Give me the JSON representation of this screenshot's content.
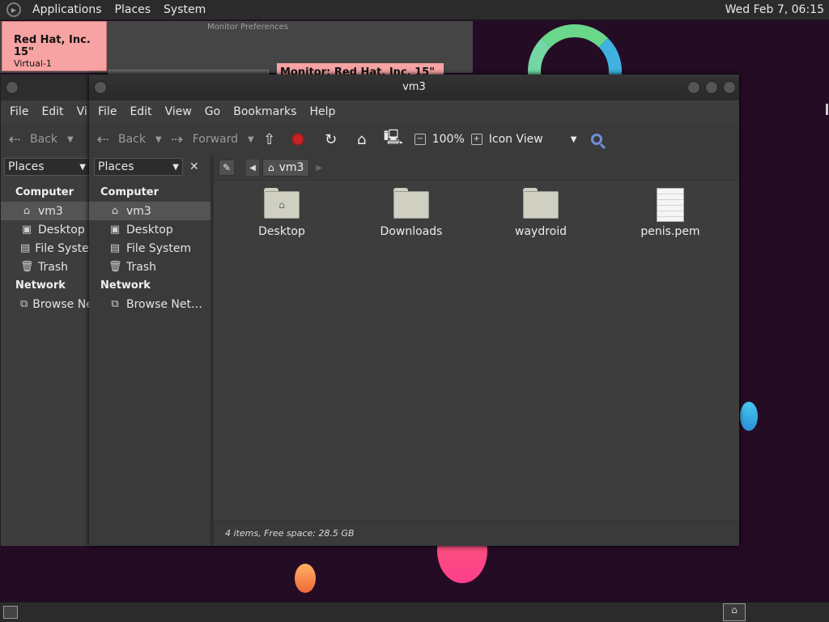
{
  "top_panel": {
    "menus": [
      "Applications",
      "Places",
      "System"
    ],
    "clock": "Wed Feb  7, 06:15"
  },
  "monitor_prefs": {
    "title": "Monitor Preferences",
    "card_title": "Red Hat, Inc. 15\"",
    "card_sub": "Virtual-1",
    "monitor_label": "Monitor: Red Hat, Inc. 15\""
  },
  "window": {
    "title": "vm3",
    "menus": [
      "File",
      "Edit",
      "View",
      "Go",
      "Bookmarks",
      "Help"
    ],
    "toolbar": {
      "back_label": "Back",
      "forward_label": "Forward",
      "zoom": "100%",
      "view_mode": "Icon View"
    },
    "sidebar": {
      "selector": "Places",
      "sections": [
        {
          "title": "Computer",
          "items": [
            {
              "label": "vm3",
              "icon": "home-icon"
            },
            {
              "label": "Desktop",
              "icon": "desktop-icon"
            },
            {
              "label": "File System",
              "icon": "drive-icon"
            },
            {
              "label": "Trash",
              "icon": "trash-icon"
            }
          ]
        },
        {
          "title": "Network",
          "items": [
            {
              "label": "Browse Net…",
              "icon": "network-icon"
            }
          ]
        }
      ]
    },
    "location": {
      "crumb": "vm3"
    },
    "files": [
      {
        "name": "Desktop",
        "type": "folder"
      },
      {
        "name": "Downloads",
        "type": "folder"
      },
      {
        "name": "waydroid",
        "type": "folder"
      },
      {
        "name": "penis.pem",
        "type": "file"
      }
    ],
    "status": "4 items, Free space: 28.5 GB"
  },
  "shadow_window": {
    "menus": [
      "File",
      "Edit",
      "Vi"
    ],
    "back_label": "Back",
    "selector": "Places",
    "sections": [
      {
        "title": "Computer",
        "items": [
          "vm3",
          "Desktop",
          "File Syster",
          "Trash"
        ]
      },
      {
        "title": "Network",
        "items": [
          "Browse Ne"
        ]
      }
    ]
  }
}
